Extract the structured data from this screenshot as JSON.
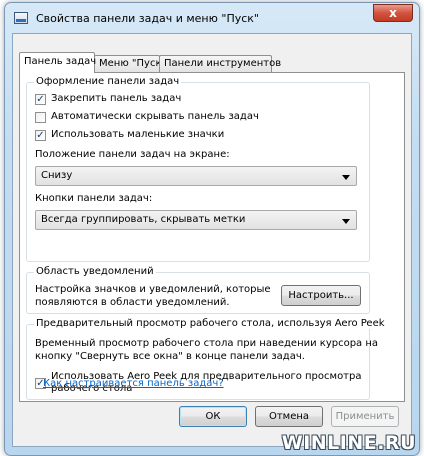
{
  "window": {
    "title": "Свойства панели задач и меню \"Пуск\"",
    "close_label": "x"
  },
  "tabs": [
    {
      "label": "Панель задач",
      "active": true
    },
    {
      "label": "Меню \"Пуск\"",
      "active": false
    },
    {
      "label": "Панели инструментов",
      "active": false
    }
  ],
  "taskbar_group": {
    "title": "Оформление панели задач",
    "checkboxes": [
      {
        "label": "Закрепить панель задач",
        "checked": true
      },
      {
        "label": "Автоматически скрывать панель задач",
        "checked": false
      },
      {
        "label": "Использовать маленькие значки",
        "checked": true
      }
    ],
    "position_label": "Положение панели задач на экране:",
    "position_value": "Снизу",
    "buttons_label": "Кнопки панели задач:",
    "buttons_value": "Всегда группировать, скрывать метки"
  },
  "notification_group": {
    "title": "Область уведомлений",
    "description_line1": "Настройка значков и уведомлений, которые",
    "description_line2": "появляются в области уведомлений.",
    "customize_button": "Настроить..."
  },
  "aero_group": {
    "title": "Предварительный просмотр рабочего стола, используя Aero Peek",
    "description_line1": "Временный просмотр рабочего стола при наведении курсора на",
    "description_line2": "кнопку \"Свернуть все окна\" в конце панели задач.",
    "checkbox_line1": "Использовать Aero Peek для предварительного просмотра",
    "checkbox_line2": "рабочего стола",
    "checkbox_checked": true
  },
  "help_link": "Как настраивается панель задач?",
  "footer": {
    "ok": "ОК",
    "cancel": "Отмена",
    "apply": "Применить"
  },
  "watermark": "WINLINE.RU",
  "check_glyph": "✓"
}
